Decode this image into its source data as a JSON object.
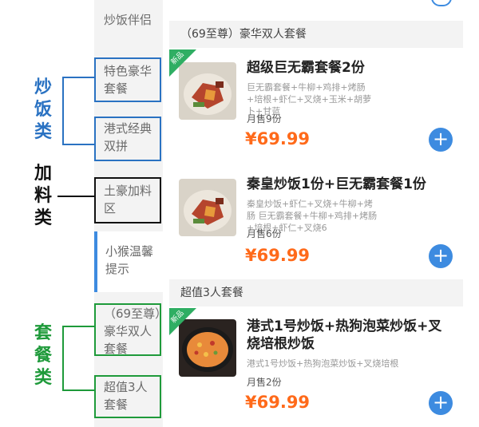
{
  "annotations": {
    "group_fried_rice": "炒饭类",
    "group_addons": "加料类",
    "group_sets": "套餐类"
  },
  "sidebar": {
    "items": [
      {
        "label": "炒饭伴侣"
      },
      {
        "label": "特色豪华套餐"
      },
      {
        "label": "港式经典双拼"
      },
      {
        "label": "土豪加料区"
      },
      {
        "label": "小猴温馨提示"
      },
      {
        "label": "（69至尊）豪华双人套餐"
      },
      {
        "label": "超值3人套餐"
      }
    ]
  },
  "sections": [
    {
      "title": "（69至尊）豪华双人套餐",
      "products": [
        {
          "name": "超级巨无霸套餐2份",
          "desc": "巨无霸套餐+牛柳+鸡排+烤肠+培根+虾仁+叉烧+玉米+胡萝卜+甘蓝",
          "sold": "月售9份",
          "price": "¥69.99",
          "badge": "新品",
          "add": "+"
        },
        {
          "name": "秦皇炒饭1份+巨无霸套餐1份",
          "desc": "秦皇炒饭+虾仁+叉烧+牛柳+烤肠 巨无霸套餐+牛柳+鸡排+烤肠+培根+虾仁+叉烧6",
          "sold": "月售6份",
          "price": "¥69.99",
          "add": "+"
        }
      ]
    },
    {
      "title": "超值3人套餐",
      "products": [
        {
          "name": "港式1号炒饭+热狗泡菜炒饭+叉烧培根炒饭",
          "desc": "港式1号炒饭+热狗泡菜炒饭+叉烧培根",
          "sold": "月售2份",
          "price": "¥69.99",
          "badge": "新品",
          "add": "+"
        }
      ]
    }
  ],
  "colors": {
    "accent": "#3d8be0",
    "price": "#ff6a1a",
    "group_blue": "#2a72c2",
    "group_green": "#1e9a3a",
    "sidebar_bg": "#f3f3f3",
    "badge": "#2fae63"
  }
}
